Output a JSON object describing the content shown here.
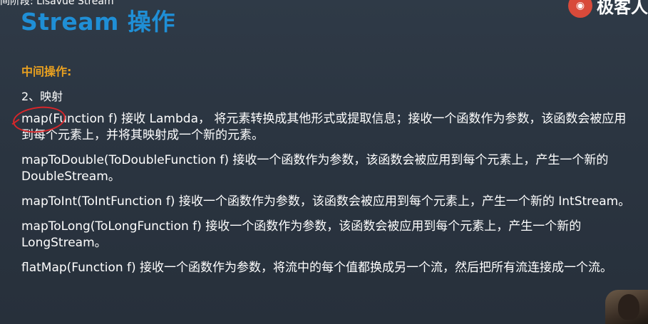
{
  "top_caption": "间阶段: Lisavue Stream",
  "title": "Stream 操作",
  "logo": {
    "text": "极客人"
  },
  "section_label": "中间操作:",
  "sub_heading": "2、映射",
  "operations": [
    {
      "text": "map(Function f) 接收 Lambda， 将元素转换成其他形式或提取信息；接收一个函数作为参数，该函数会被应用到每个元素上，并将其映射成一个新的元素。"
    },
    {
      "text": "mapToDouble(ToDoubleFunction f) 接收一个函数作为参数，该函数会被应用到每个元素上，产生一个新的 DoubleStream。"
    },
    {
      "text": "mapToInt(ToIntFunction f) 接收一个函数作为参数，该函数会被应用到每个元素上，产生一个新的 IntStream。"
    },
    {
      "text": "mapToLong(ToLongFunction f) 接收一个函数作为参数，该函数会被应用到每个元素上，产生一个新的 LongStream。"
    },
    {
      "text": "flatMap(Function f) 接收一个函数作为参数，将流中的每个值都换成另一个流，然后把所有流连接成一个流。"
    }
  ],
  "colors": {
    "title": "#1f8fd6",
    "section_label": "#e8a020",
    "annotation": "#d8262a",
    "background": "#2b3541"
  }
}
